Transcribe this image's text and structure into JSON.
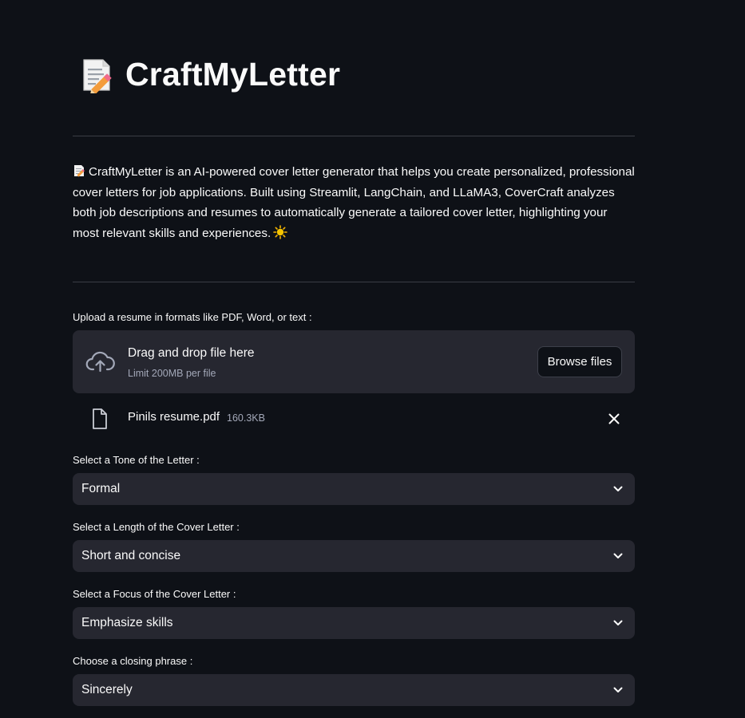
{
  "app": {
    "title": "CraftMyLetter",
    "description": "CraftMyLetter is an AI-powered cover letter generator that helps you create personalized, professional cover letters for job applications. Built using Streamlit, LangChain, and LLaMA3, CoverCraft analyzes both job descriptions and resumes to automatically generate a tailored cover letter, highlighting your most relevant skills and experiences."
  },
  "uploader": {
    "label": "Upload a resume in formats like PDF, Word, or text :",
    "drag_text": "Drag and drop file here",
    "limit_text": "Limit 200MB per file",
    "browse_label": "Browse files",
    "file": {
      "name": "Pinils resume.pdf",
      "size": "160.3KB"
    }
  },
  "selects": {
    "tone": {
      "label": "Select a Tone of the Letter :",
      "value": "Formal"
    },
    "length": {
      "label": "Select a Length of the Cover Letter :",
      "value": "Short and concise"
    },
    "focus": {
      "label": "Select a Focus of the Cover Letter :",
      "value": "Emphasize skills"
    },
    "closing": {
      "label": "Choose a closing phrase :",
      "value": "Sincerely"
    }
  },
  "icons": {
    "title": "memo-icon",
    "description": "memo-icon",
    "description_end": "sun-icon",
    "upload": "cloud-upload-icon",
    "file": "file-icon",
    "remove": "close-icon",
    "select": "chevron-down-icon"
  },
  "colors": {
    "background": "#0e1117",
    "surface": "#262730",
    "text": "#fafafa",
    "muted": "#a3a8b8",
    "divider": "#3a3d45"
  }
}
